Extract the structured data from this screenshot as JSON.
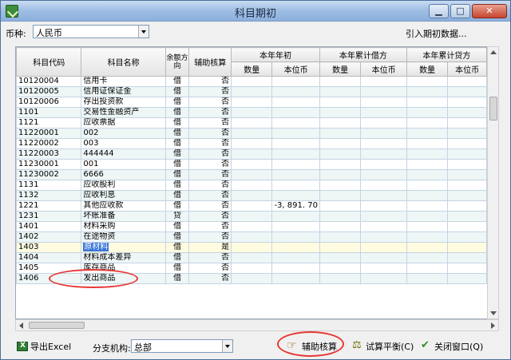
{
  "window": {
    "title": "科目期初"
  },
  "titlebar_buttons": {
    "minimize": "▁",
    "maximize": "□",
    "close": "✕"
  },
  "toolbar": {
    "currency_label": "币种:",
    "currency_value": "人民币",
    "import_link": "引入期初数据..."
  },
  "table": {
    "col_code": "科目代码",
    "col_name": "科目名称",
    "col_direction": "余额方向",
    "col_aux": "辅助核算",
    "group_year_begin": "本年年初",
    "group_debit": "本年累计借方",
    "group_credit": "本年累计贷方",
    "sub_qty": "数量",
    "sub_base": "本位币",
    "rows": [
      {
        "code": "10120004",
        "name": "信用卡",
        "dir": "借",
        "aux": "否",
        "base": ""
      },
      {
        "code": "10120005",
        "name": "信用证保证金",
        "dir": "借",
        "aux": "否",
        "base": ""
      },
      {
        "code": "10120006",
        "name": "存出投资款",
        "dir": "借",
        "aux": "否",
        "base": ""
      },
      {
        "code": "1101",
        "name": "交易性金融资产",
        "dir": "借",
        "aux": "否",
        "base": ""
      },
      {
        "code": "1121",
        "name": "应收票据",
        "dir": "借",
        "aux": "否",
        "base": ""
      },
      {
        "code": "11220001",
        "name": "002",
        "dir": "借",
        "aux": "否",
        "base": ""
      },
      {
        "code": "11220002",
        "name": "003",
        "dir": "借",
        "aux": "否",
        "base": ""
      },
      {
        "code": "11220003",
        "name": "444444",
        "dir": "借",
        "aux": "否",
        "base": ""
      },
      {
        "code": "11230001",
        "name": "001",
        "dir": "借",
        "aux": "否",
        "base": ""
      },
      {
        "code": "11230002",
        "name": "6666",
        "dir": "借",
        "aux": "否",
        "base": ""
      },
      {
        "code": "1131",
        "name": "应收股利",
        "dir": "借",
        "aux": "否",
        "base": ""
      },
      {
        "code": "1132",
        "name": "应收利息",
        "dir": "借",
        "aux": "否",
        "base": ""
      },
      {
        "code": "1221",
        "name": "其他应收款",
        "dir": "借",
        "aux": "否",
        "base": "-3, 891. 70"
      },
      {
        "code": "1231",
        "name": "坏账准备",
        "dir": "贷",
        "aux": "否",
        "base": ""
      },
      {
        "code": "1401",
        "name": "材料采购",
        "dir": "借",
        "aux": "否",
        "base": ""
      },
      {
        "code": "1402",
        "name": "在途物资",
        "dir": "借",
        "aux": "否",
        "base": ""
      },
      {
        "code": "1403",
        "name": "原材料",
        "dir": "借",
        "aux": "是",
        "base": ""
      },
      {
        "code": "1404",
        "name": "材料成本差异",
        "dir": "借",
        "aux": "否",
        "base": ""
      },
      {
        "code": "1405",
        "name": "库存商品",
        "dir": "借",
        "aux": "否",
        "base": ""
      },
      {
        "code": "1406",
        "name": "发出商品",
        "dir": "借",
        "aux": "否",
        "base": ""
      }
    ]
  },
  "bottom": {
    "export_excel": "导出Excel",
    "branch_label": "分支机构:",
    "branch_value": "总部",
    "aux_button": "辅助核算",
    "trial_balance_button": "试算平衡(C)",
    "close_button": "关闭窗口(Q)"
  }
}
